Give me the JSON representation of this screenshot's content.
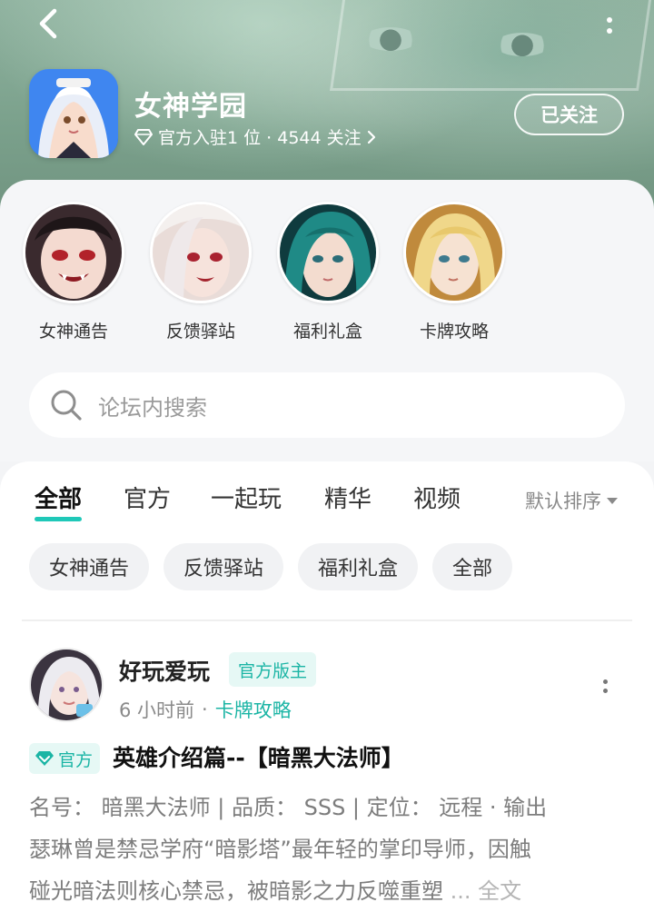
{
  "header": {
    "forum_name": "女神学园",
    "meta_text": "官方入驻1 位 · 4544 关注",
    "follow_label": "已关注"
  },
  "channels": [
    {
      "label": "女神通告"
    },
    {
      "label": "反馈驿站"
    },
    {
      "label": "福利礼盒"
    },
    {
      "label": "卡牌攻略"
    }
  ],
  "search": {
    "placeholder": "论坛内搜索"
  },
  "tabs": [
    {
      "label": "全部",
      "active": true
    },
    {
      "label": "官方"
    },
    {
      "label": "一起玩"
    },
    {
      "label": "精华"
    },
    {
      "label": "视频"
    }
  ],
  "sort": {
    "label": "默认排序"
  },
  "chips": [
    "女神通告",
    "反馈驿站",
    "福利礼盒",
    "全部"
  ],
  "post": {
    "author": "好玩爱玩",
    "role": "官方版主",
    "time": "6 小时前",
    "separator": "·",
    "category": "卡牌攻略",
    "tag": "官方",
    "title": "英雄介绍篇--【暗黑大法师】",
    "body_lines": [
      "名号： 暗黑大法师 | 品质： SSS | 定位： 远程 · 输出",
      "瑟琳曾是禁忌学府“暗影塔”最年轻的掌印导师，因触",
      "碰光暗法则核心禁忌，被暗影之力反噬重塑"
    ],
    "ellipsis": " ... ",
    "more_label": "全文"
  },
  "colors": {
    "accent": "#1fc8b8",
    "accent_text": "#1bb5a5",
    "banner": "#7aa08b"
  }
}
